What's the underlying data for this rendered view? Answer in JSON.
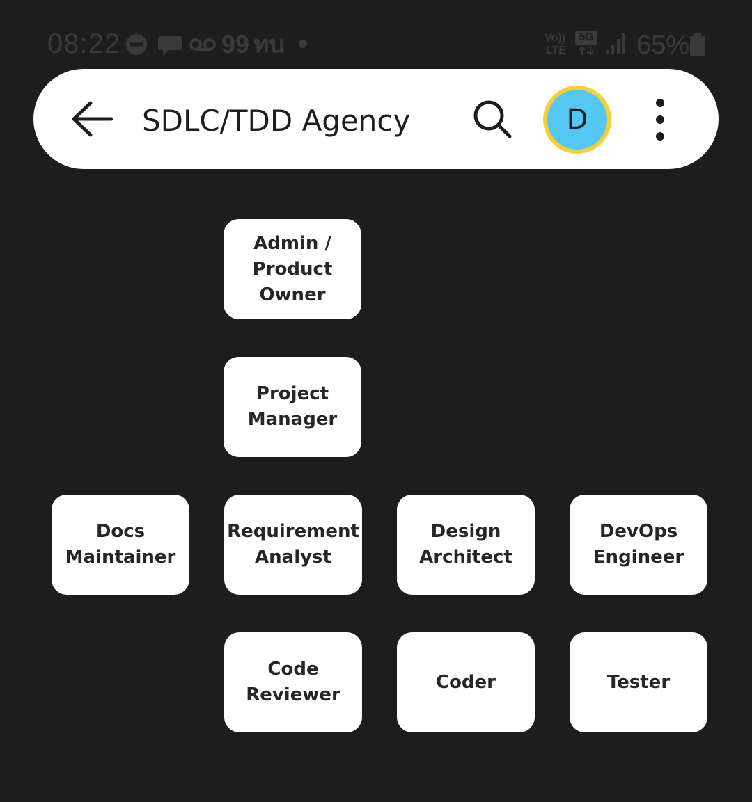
{
  "status_bar": {
    "time": "08:22",
    "notification_count": "99",
    "network_text": "ทบ",
    "volte_label": "Vo))",
    "lte_label": "LTE",
    "network_type": "5G",
    "battery_percent": "65%",
    "icons": [
      "do-not-disturb-icon",
      "chat-bubble-icon",
      "voicemail-icon",
      "dot-icon",
      "signal-icon",
      "battery-icon"
    ]
  },
  "app_bar": {
    "title": "SDLC/TDD Agency",
    "avatar_letter": "D",
    "colors": {
      "avatar_fill": "#54c8f2",
      "avatar_ring": "#f5cf3c",
      "bar_background": "#ffffff"
    }
  },
  "org_chart": {
    "nodes": [
      {
        "label": "Admin /\nProduct\nOwner"
      },
      {
        "label": "Project\nManager"
      },
      {
        "label": "Docs\nMaintainer"
      },
      {
        "label": "Requirement\nAnalyst"
      },
      {
        "label": "Design\nArchitect"
      },
      {
        "label": "DevOps\nEngineer"
      },
      {
        "label": "Code\nReviewer"
      },
      {
        "label": "Coder"
      },
      {
        "label": "Tester"
      }
    ]
  },
  "colors": {
    "background": "#1d1d1d",
    "node_background": "#ffffff",
    "node_text": "#262626"
  }
}
